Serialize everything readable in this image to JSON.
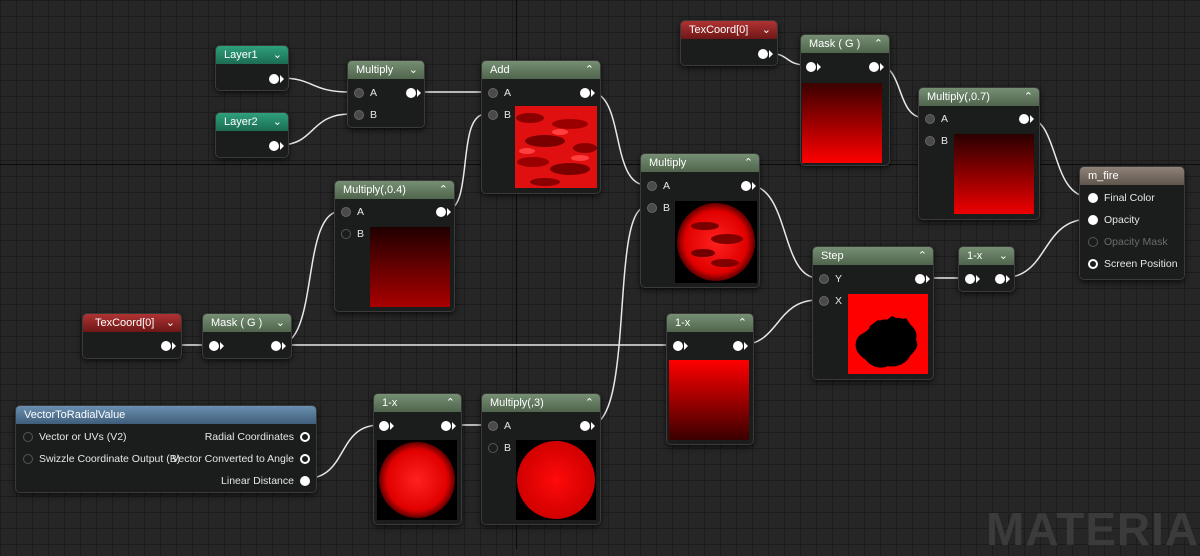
{
  "watermark": "MATERIAL",
  "nodes": {
    "layer1": {
      "title": "Layer1"
    },
    "layer2": {
      "title": "Layer2"
    },
    "multiply": {
      "title": "Multiply",
      "in_a": "A",
      "in_b": "B"
    },
    "add": {
      "title": "Add",
      "in_a": "A",
      "in_b": "B"
    },
    "texcoord_top": {
      "title": "TexCoord[0]"
    },
    "mask_top": {
      "title": "Mask ( G )"
    },
    "multiply07": {
      "title": "Multiply(,0.7)",
      "in_a": "A",
      "in_b": "B"
    },
    "multiply04": {
      "title": "Multiply(,0.4)",
      "in_a": "A",
      "in_b": "B"
    },
    "multiply_mid": {
      "title": "Multiply",
      "in_a": "A",
      "in_b": "B"
    },
    "step": {
      "title": "Step",
      "in_y": "Y",
      "in_x": "X"
    },
    "oneminus_right": {
      "title": "1-x"
    },
    "m_fire": {
      "title": "m_fire",
      "pins": [
        "Final Color",
        "Opacity",
        "Opacity Mask",
        "Screen Position"
      ]
    },
    "texcoord_left": {
      "title": "TexCoord[0]"
    },
    "mask_left": {
      "title": "Mask ( G )"
    },
    "oneminus_mid": {
      "title": "1-x"
    },
    "vtr": {
      "title": "VectorToRadialValue",
      "in1": "Vector or UVs (V2)",
      "in2": "Swizzle Coordinate Output (B)",
      "out1": "Radial Coordinates",
      "out2": "Vector Converted to Angle",
      "out3": "Linear Distance"
    },
    "oneminus_bottom": {
      "title": "1-x"
    },
    "multiply3": {
      "title": "Multiply(,3)",
      "in_a": "A",
      "in_b": "B"
    }
  },
  "colors": {
    "canvas": "#262626",
    "param_header": "#2fa07c",
    "texcoord_header": "#b03333",
    "math_header": "#768f73",
    "function_header": "#6a8fb0",
    "result_header": "#8f8378"
  }
}
